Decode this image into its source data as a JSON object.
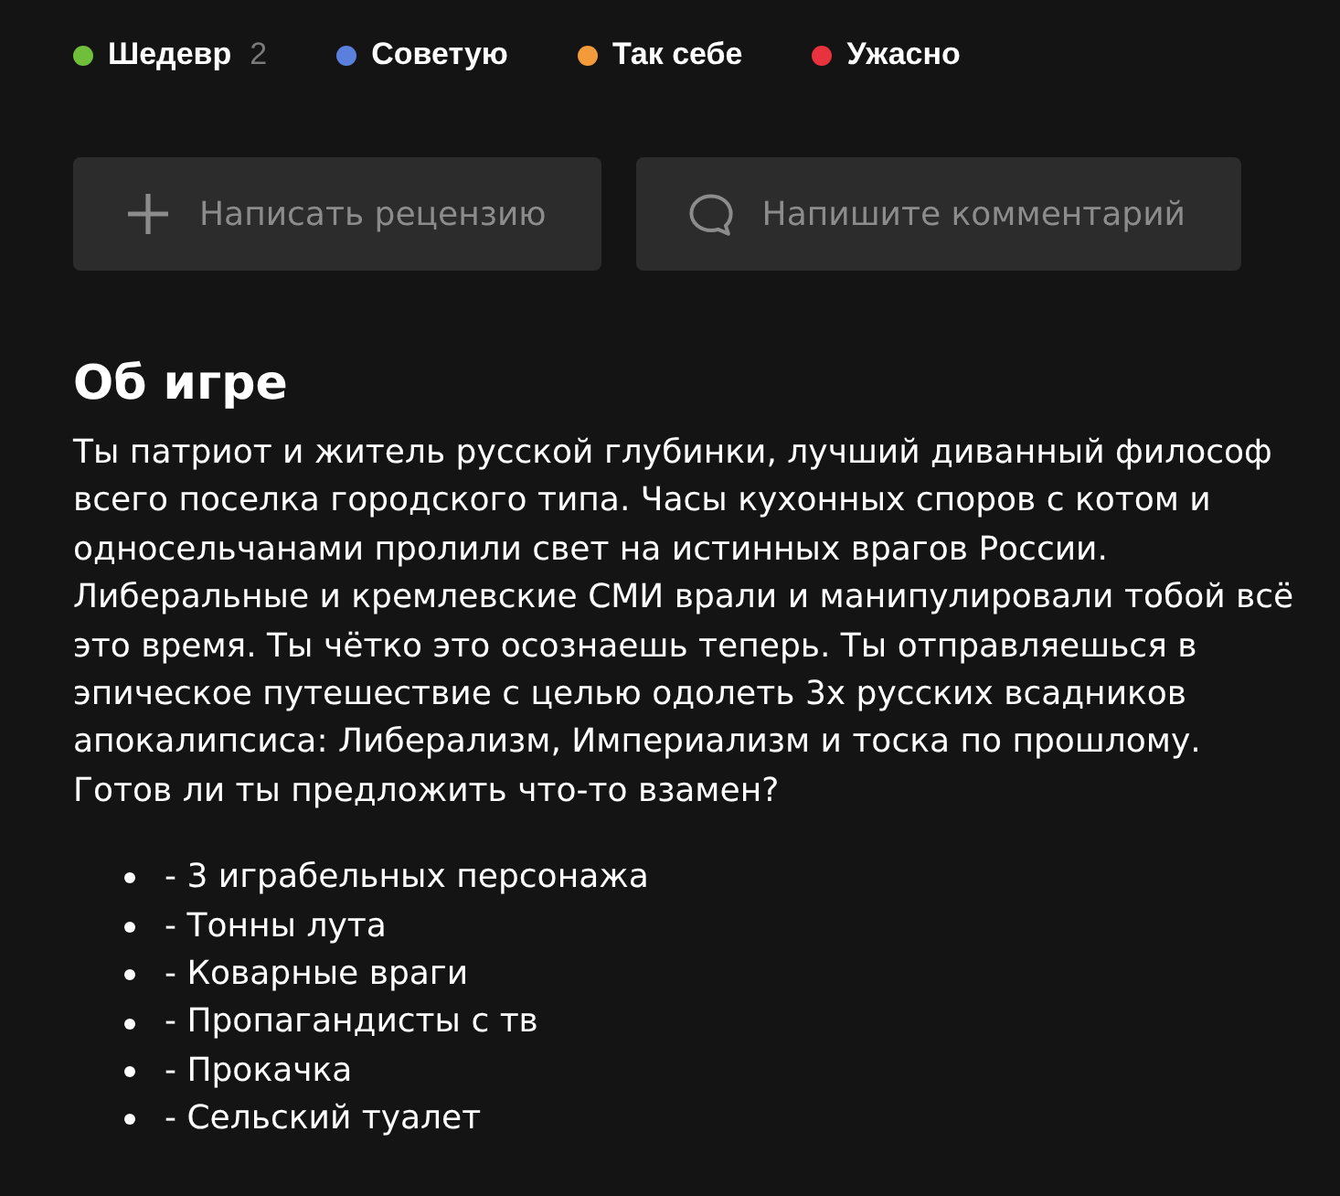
{
  "ratings": [
    {
      "label": "Шедевр",
      "count": "2",
      "color": "#6fbf3a"
    },
    {
      "label": "Советую",
      "color": "#5b7fdc"
    },
    {
      "label": "Так себе",
      "color": "#f39a3a"
    },
    {
      "label": "Ужасно",
      "color": "#e8323e"
    }
  ],
  "actions": [
    {
      "kind": "review",
      "label": "Написать рецензию"
    },
    {
      "kind": "comment",
      "label": "Напишите комментарий"
    }
  ],
  "about": {
    "title": "Об игре",
    "description": "Ты патриот и житель русской глубинки, лучший диванный философ всего поселка городского типа. Часы кухонных споров с котом и односельчанами пролили свет на истинных врагов России. Либеральные и кремлевские СМИ врали и манипулировали тобой всё это время. Ты чётко это осознаешь теперь. Ты отправляешься в эпическое путешествие с целью одолеть 3х русских всадников апокалипсиса: Либерализм, Империализм и тоска по прошлому. Готов ли ты предложить что-то взамен?",
    "features": [
      "- 3 играбельных персонажа",
      "- Тонны лута",
      "- Коварные враги",
      "- Пропагандисты с тв",
      "- Прокачка",
      "- Сельский туалет"
    ]
  }
}
